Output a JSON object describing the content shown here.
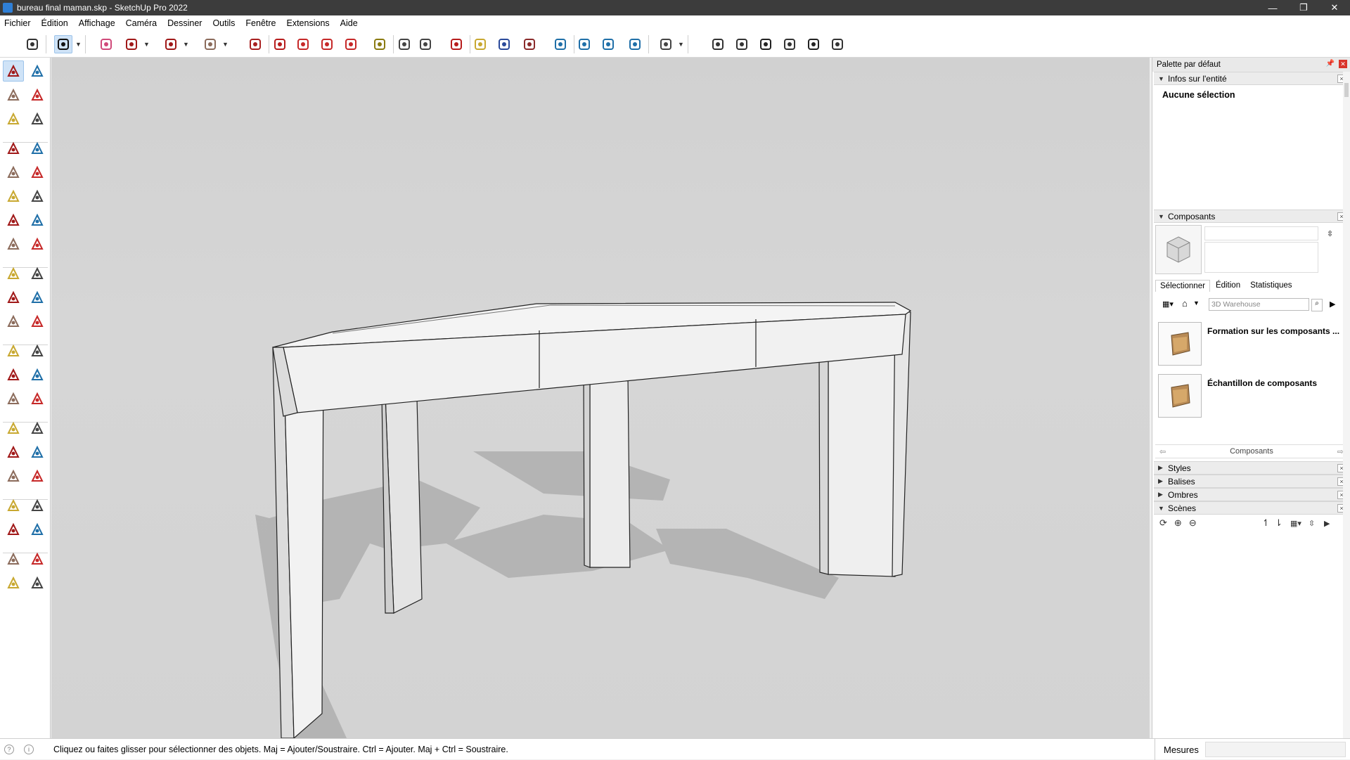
{
  "window": {
    "title": "bureau  final maman.skp - SketchUp Pro 2022",
    "minimize_glyph": "—",
    "maximize_glyph": "❐",
    "close_glyph": "✕"
  },
  "menu": [
    "Fichier",
    "Édition",
    "Affichage",
    "Caméra",
    "Dessiner",
    "Outils",
    "Fenêtre",
    "Extensions",
    "Aide"
  ],
  "toolbar": {
    "icons": [
      "search-icon",
      "select-icon",
      "eraser-icon",
      "pencil-icon",
      "arc-icon",
      "rectangle-icon",
      "push-pull-icon",
      "follow-me-icon",
      "move-icon",
      "rotate-icon",
      "scale-icon",
      "tape-measure-icon",
      "text-icon",
      "paint-bucket-icon",
      "orbit-icon",
      "pan-icon",
      "zoom-icon",
      "zoom-extents-icon",
      "sandbox-icon",
      "sandbox-smoove-icon",
      "sandbox-stamp-icon",
      "sandbox-drape-icon",
      "profile-icon",
      "iso-view-icon",
      "front-view-icon",
      "home-view-icon",
      "top-view-icon",
      "right-view-icon",
      "back-view-icon"
    ]
  },
  "tray": {
    "title": "Palette par défaut",
    "entity_info": {
      "header": "Infos sur l'entité",
      "value": "Aucune sélection"
    },
    "components": {
      "header": "Composants",
      "tabs": [
        "Sélectionner",
        "Édition",
        "Statistiques"
      ],
      "search_placeholder": "3D Warehouse",
      "items": [
        {
          "name": "Formation sur les composants ..."
        },
        {
          "name": "Échantillon de composants"
        }
      ],
      "footer": "Composants"
    },
    "collapsed_panels": [
      "Styles",
      "Balises",
      "Ombres"
    ],
    "scenes": {
      "header": "Scènes"
    }
  },
  "status": {
    "hint": "Cliquez ou faites glisser pour sélectionner des objets. Maj = Ajouter/Soustraire. Ctrl = Ajouter. Maj + Ctrl = Soustraire.",
    "measures_label": "Mesures",
    "measures_value": ""
  }
}
